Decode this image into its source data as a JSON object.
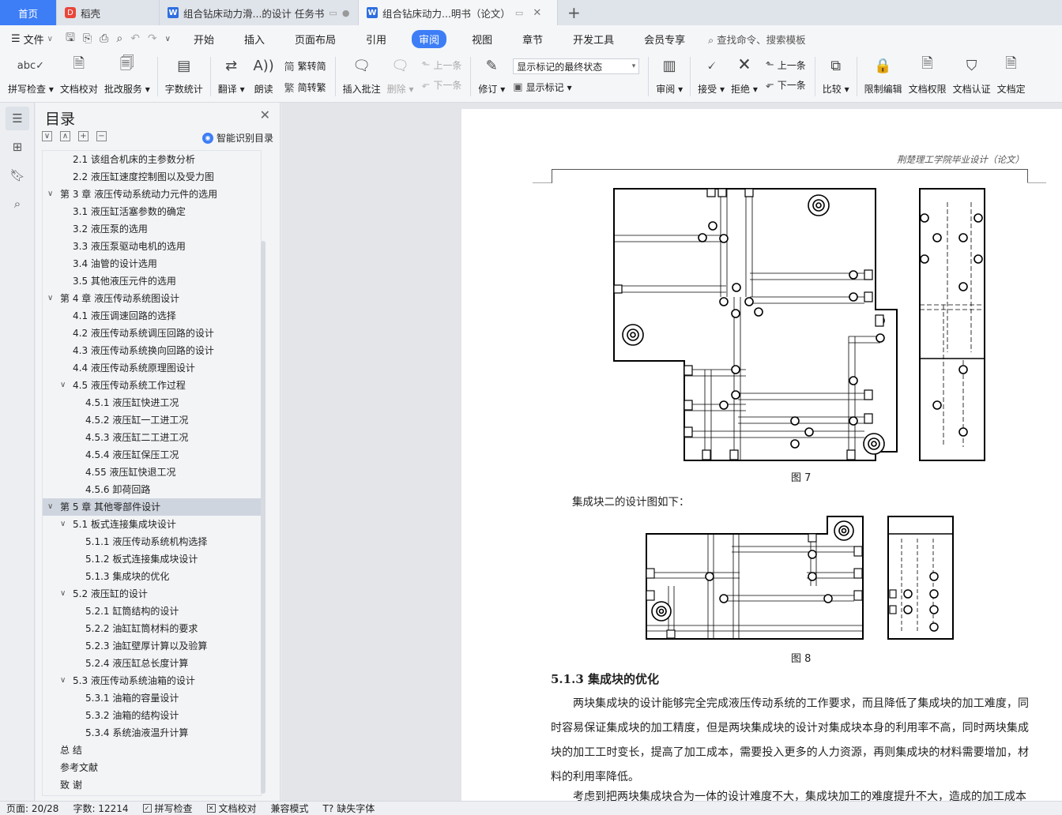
{
  "tabs": [
    {
      "label": "首页",
      "kind": "home"
    },
    {
      "label": "稻壳",
      "kind": "docer"
    },
    {
      "label": "组合钻床动力滑...的设计 任务书",
      "kind": "doc"
    },
    {
      "label": "组合钻床动力...明书（论文）",
      "kind": "doc-active"
    }
  ],
  "menu": {
    "file": "文件",
    "tabs": [
      "开始",
      "插入",
      "页面布局",
      "引用",
      "审阅",
      "视图",
      "章节",
      "开发工具",
      "会员专享"
    ],
    "active": "审阅",
    "search": "查找命令、搜索模板"
  },
  "ribbon": {
    "spell": "拼写检查",
    "proof": "文档校对",
    "batch": "批改服务",
    "wordcount": "字数统计",
    "translate": "翻译",
    "read": "朗读",
    "to_trad": "繁转简",
    "to_simp": "简转繁",
    "insert_comment": "插入批注",
    "delete": "删除",
    "prev_comment": "上一条",
    "next_comment": "下一条",
    "revise": "修订",
    "display_select": "显示标记的最终状态",
    "show_marks": "显示标记",
    "review": "审阅",
    "accept": "接受",
    "reject": "拒绝",
    "prev": "上一条",
    "next": "下一条",
    "compare": "比较",
    "restrict": "限制编辑",
    "perm": "文档权限",
    "cert": "文档认证",
    "final": "文档定"
  },
  "toc": {
    "title": "目录",
    "smart": "智能识别目录",
    "items": [
      {
        "text": "2.1  该组合机床的主参数分析",
        "level": 2,
        "arrow": ""
      },
      {
        "text": "2.2  液压缸速度控制图以及受力图",
        "level": 2,
        "arrow": ""
      },
      {
        "text": "第 3 章  液压传动系统动力元件的选用",
        "level": 1,
        "arrow": "v"
      },
      {
        "text": "3.1  液压缸活塞参数的确定",
        "level": 2,
        "arrow": ""
      },
      {
        "text": "3.2  液压泵的选用",
        "level": 2,
        "arrow": ""
      },
      {
        "text": "3.3  液压泵驱动电机的选用",
        "level": 2,
        "arrow": ""
      },
      {
        "text": "3.4  油管的设计选用",
        "level": 2,
        "arrow": ""
      },
      {
        "text": "3.5  其他液压元件的选用",
        "level": 2,
        "arrow": ""
      },
      {
        "text": "第 4 章  液压传动系统图设计",
        "level": 1,
        "arrow": "v"
      },
      {
        "text": "4.1  液压调速回路的选择",
        "level": 2,
        "arrow": ""
      },
      {
        "text": "4.2  液压传动系统调压回路的设计",
        "level": 2,
        "arrow": ""
      },
      {
        "text": "4.3  液压传动系统换向回路的设计",
        "level": 2,
        "arrow": ""
      },
      {
        "text": "4.4  液压传动系统原理图设计",
        "level": 2,
        "arrow": ""
      },
      {
        "text": "4.5  液压传动系统工作过程",
        "level": 2,
        "arrow": "v"
      },
      {
        "text": "4.5.1  液压缸快进工况",
        "level": 3,
        "arrow": ""
      },
      {
        "text": "4.5.2  液压缸一工进工况",
        "level": 3,
        "arrow": ""
      },
      {
        "text": "4.5.3 液压缸二工进工况",
        "level": 3,
        "arrow": ""
      },
      {
        "text": "4.5.4  液压缸保压工况",
        "level": 3,
        "arrow": ""
      },
      {
        "text": "4.55  液压缸快退工况",
        "level": 3,
        "arrow": ""
      },
      {
        "text": "4.5.6  卸荷回路",
        "level": 3,
        "arrow": ""
      },
      {
        "text": "第 5 章  其他零部件设计",
        "level": 1,
        "arrow": "v",
        "selected": true
      },
      {
        "text": "5.1  板式连接集成块设计",
        "level": 2,
        "arrow": "v"
      },
      {
        "text": "5.1.1  液压传动系统机构选择",
        "level": 3,
        "arrow": ""
      },
      {
        "text": "5.1.2  板式连接集成块设计",
        "level": 3,
        "arrow": ""
      },
      {
        "text": "5.1.3  集成块的优化",
        "level": 3,
        "arrow": ""
      },
      {
        "text": "5.2  液压缸的设计",
        "level": 2,
        "arrow": "v"
      },
      {
        "text": "5.2.1  缸筒结构的设计",
        "level": 3,
        "arrow": ""
      },
      {
        "text": "5.2.2  油缸缸筒材料的要求",
        "level": 3,
        "arrow": ""
      },
      {
        "text": "5.2.3  油缸壁厚计算以及验算",
        "level": 3,
        "arrow": ""
      },
      {
        "text": "5.2.4  液压缸总长度计算",
        "level": 3,
        "arrow": ""
      },
      {
        "text": "5.3  液压传动系统油箱的设计",
        "level": 2,
        "arrow": "v"
      },
      {
        "text": "5.3.1  油箱的容量设计",
        "level": 3,
        "arrow": ""
      },
      {
        "text": "5.3.2  油箱的结构设计",
        "level": 3,
        "arrow": ""
      },
      {
        "text": "5.3.4  系统油液温升计算",
        "level": 3,
        "arrow": ""
      },
      {
        "text": "总    结",
        "level": 1,
        "arrow": ""
      },
      {
        "text": "参考文献",
        "level": 1,
        "arrow": ""
      },
      {
        "text": "致    谢",
        "level": 1,
        "arrow": ""
      }
    ]
  },
  "document": {
    "header": "荆楚理工学院毕业设计（论文）",
    "fig7": "图 7",
    "intro": "集成块二的设计图如下：",
    "fig8": "图 8",
    "section": "5.1.3  集成块的优化",
    "body": "两块集成块的设计能够完全完成液压传动系统的工作要求，而且降低了集成块的加工难度，同时容易保证集成块的加工精度，但是两块集成块的设计对集成块本身的利用率不高，同时两块集成块的加工工时变长，提高了加工成本，需要投入更多的人力资源，再则集成块的材料需要增加，材料的利用率降低。",
    "body2": "考虑到把两块集成块合为一体的设计难度不大，集成块加工的难度提升不大，造成的加工成本"
  },
  "status": {
    "page": "页面: 20/28",
    "words": "字数: 12214",
    "spell": "拼写检查",
    "proof": "文档校对",
    "compat": "兼容模式",
    "font": "缺失字体"
  }
}
